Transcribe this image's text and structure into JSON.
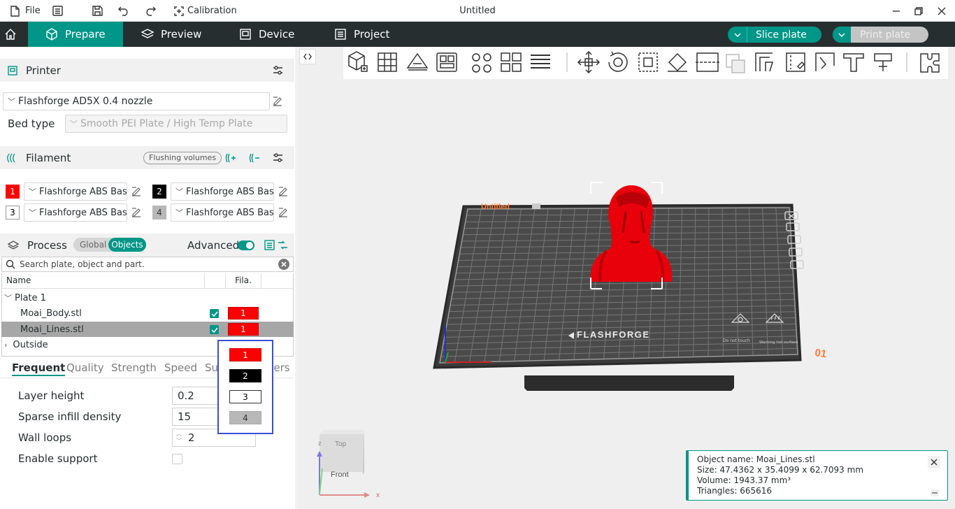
{
  "titlebar": {
    "file_label": "File",
    "calibration_label": "Calibration",
    "window_title": "Untitled"
  },
  "nav": {
    "tabs": [
      {
        "label": "Prepare",
        "icon": "cube-icon",
        "active": true
      },
      {
        "label": "Preview",
        "icon": "layers-icon",
        "active": false
      },
      {
        "label": "Device",
        "icon": "device-icon",
        "active": false
      },
      {
        "label": "Project",
        "icon": "project-icon",
        "active": false
      }
    ],
    "slice_label": "Slice plate",
    "print_label": "Print plate"
  },
  "printer": {
    "section_title": "Printer",
    "name": "Flashforge AD5X 0.4 nozzle",
    "bed_type_label": "Bed type",
    "bed_type_value": "Smooth PEI Plate / High Temp Plate"
  },
  "filament": {
    "section_title": "Filament",
    "flushing_label": "Flushing volumes",
    "slots": [
      {
        "index": "1",
        "name": "Flashforge ABS Basic",
        "color": "#ff0000"
      },
      {
        "index": "2",
        "name": "Flashforge ABS Basic",
        "color": "#000000"
      },
      {
        "index": "3",
        "name": "Flashforge ABS Basic",
        "color": "#ffffff"
      },
      {
        "index": "4",
        "name": "Flashforge ABS Basic",
        "color": "#b8b8b8"
      }
    ]
  },
  "process": {
    "section_title": "Process",
    "toggle_global": "Global",
    "toggle_objects": "Objects",
    "advanced_label": "Advanced"
  },
  "search": {
    "placeholder": "Search plate, object and part."
  },
  "object_list": {
    "col_name": "Name",
    "col_fila": "Fila.",
    "plate": "Plate 1",
    "objects": [
      {
        "name": "Moai_Body.stl",
        "filament": "1"
      },
      {
        "name": "Moai_Lines.stl",
        "filament": "1",
        "selected": true
      }
    ],
    "outside": "Outside"
  },
  "filament_dropdown": [
    "1",
    "2",
    "3",
    "4"
  ],
  "settings_tabs": [
    "Frequent",
    "Quality",
    "Strength",
    "Speed",
    "Supp",
    "thers"
  ],
  "params": {
    "layer_height_label": "Layer height",
    "layer_height_value": "0.2",
    "infill_label": "Sparse infill density",
    "infill_value": "15",
    "wall_loops_label": "Wall loops",
    "wall_loops_value": "2",
    "support_label": "Enable support"
  },
  "plate": {
    "brand": "FLASHFORGE",
    "plate_number": "01",
    "plate_label": "Untitled",
    "warning_left": "Do not touch",
    "warning_right": "Warning hot surface"
  },
  "navcube": {
    "top": "Top",
    "front": "Front",
    "axis_x": "x",
    "axis_z": "z"
  },
  "info": {
    "object_name": "Object name: Moai_Lines.stl",
    "size": "Size: 47.4362 x 35.4099 x 62.7093 mm",
    "volume": "Volume: 1943.37 mm³",
    "triangles": "Triangles: 665616"
  },
  "colors": {
    "accent": "#009688",
    "nav_bg": "#262e30",
    "model": "#e8000a",
    "dropdown_border": "#3a4fd0"
  }
}
